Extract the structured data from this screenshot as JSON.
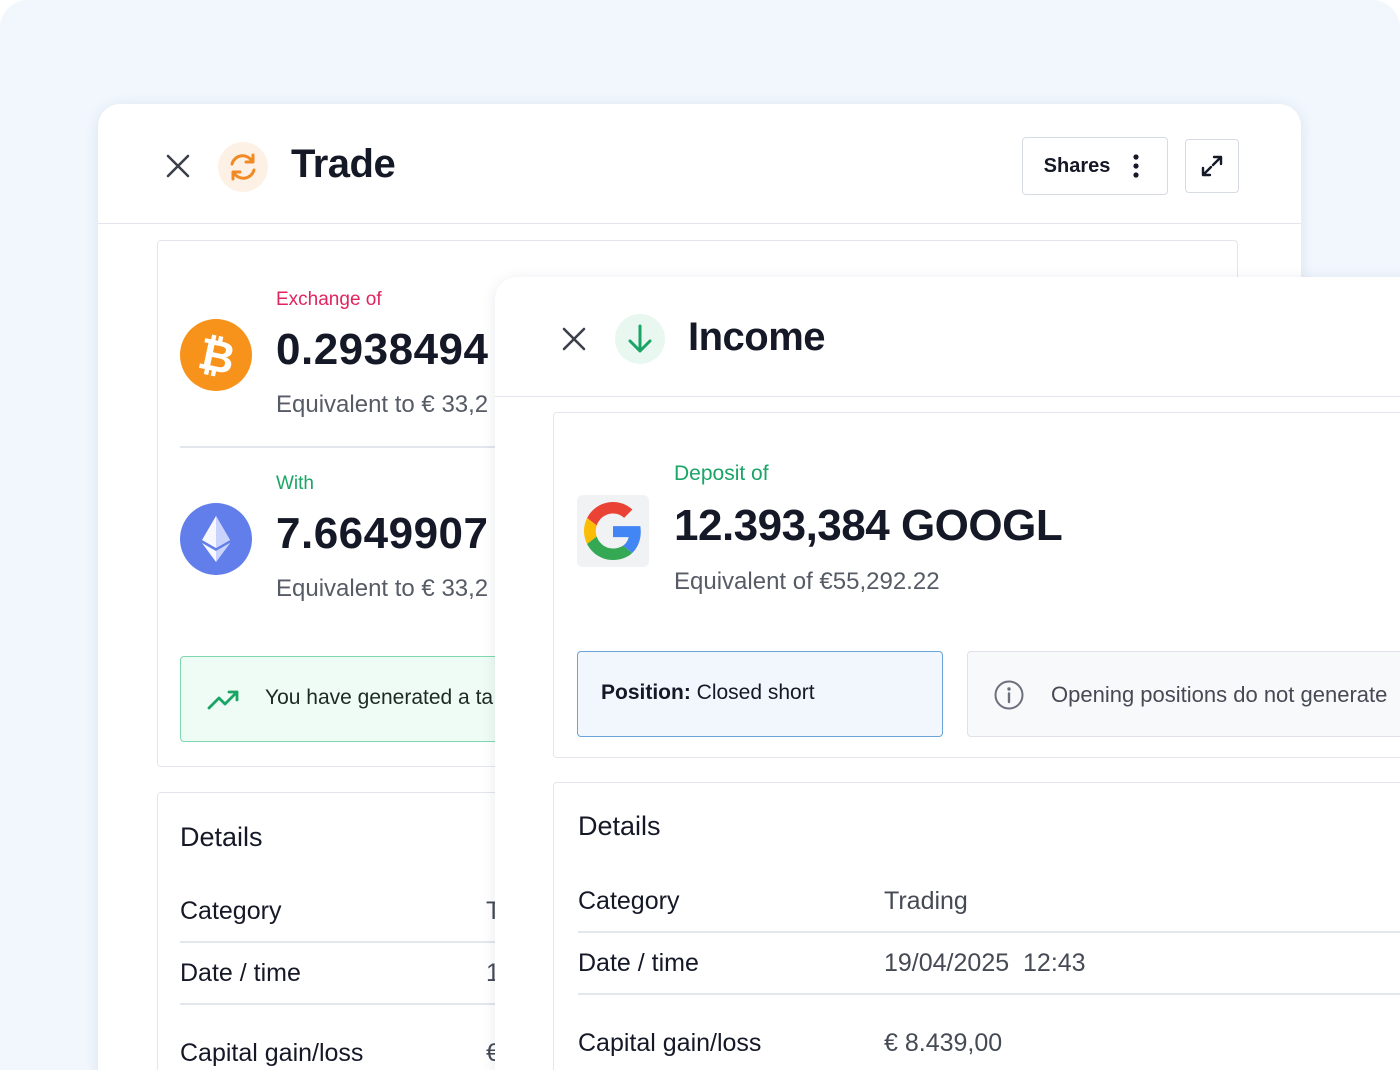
{
  "trade": {
    "title": "Trade",
    "shares_label": "Shares",
    "exchange_label": "Exchange of",
    "exchange_amount": "0.2938494",
    "exchange_equiv": "Equivalent to € 33,2",
    "with_label": "With",
    "with_amount": "7.6649907",
    "with_equiv": "Equivalent to € 33,2",
    "banner_text": "You have generated a ta",
    "details_title": "Details",
    "rows": [
      {
        "label": "Category",
        "value": "T"
      },
      {
        "label": "Date / time",
        "value": "1"
      },
      {
        "label": "Capital gain/loss",
        "value": "€"
      }
    ]
  },
  "income": {
    "title": "Income",
    "deposit_label": "Deposit of",
    "deposit_amount": "12.393,384 GOOGL",
    "deposit_equiv": "Equivalent of €55,292.22",
    "position_key": "Position:",
    "position_value": "Closed short",
    "info_text": "Opening positions do not generate",
    "details_title": "Details",
    "rows": [
      {
        "label": "Category",
        "value": "Trading"
      },
      {
        "label": "Date / time",
        "value": "19/04/2025  12:43"
      },
      {
        "label": "Capital gain/loss",
        "value": "€ 8.439,00"
      }
    ]
  },
  "icons": {
    "trade": "refresh-icon",
    "income": "arrow-down-icon",
    "bitcoin": "bitcoin-icon",
    "ethereum": "ethereum-icon",
    "google": "google-icon"
  },
  "colors": {
    "exchange_label": "#e0245e",
    "with_label": "#1aa566",
    "deposit_label": "#1aa566",
    "trade_icon": "#f08a24",
    "income_icon": "#1aa566",
    "bitcoin": "#f7931a",
    "ethereum": "#627eea",
    "banner_bg": "#effbf5",
    "banner_border": "#7fd9ae",
    "position_bg": "#f1f7fd",
    "position_border": "#6aa4d8"
  }
}
